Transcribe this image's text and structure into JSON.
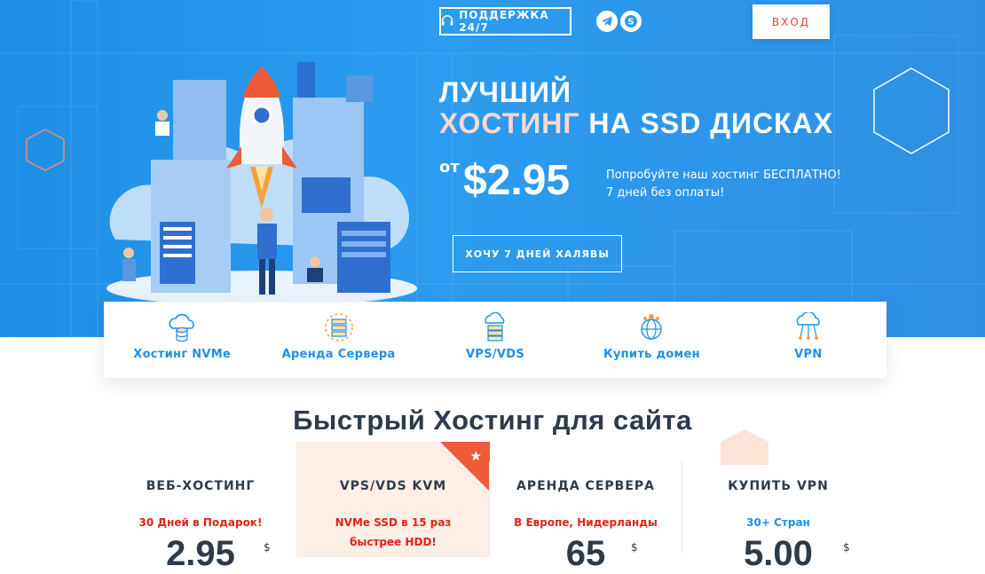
{
  "header": {
    "support_label": "ПОДДЕРЖКА 24/7",
    "support_icon": "headset-icon",
    "social": [
      {
        "icon": "telegram-icon"
      },
      {
        "icon": "skype-icon"
      }
    ],
    "login_label": "ВХОД"
  },
  "hero": {
    "title_line1": "ЛУЧШИЙ",
    "title_line2_accent": "ХОСТИНГ",
    "title_line2_rest": " НА SSD ДИСКАХ",
    "price_prefix": "от",
    "price": "$2.95",
    "promo_line1": "Попробуйте наш хостинг БЕСПЛАТНО!",
    "promo_line2": "7 дней без оплаты!",
    "cta_label": "ХОЧУ 7 ДНЕЙ ХАЛЯВЫ",
    "illustration": "rocket-datacenter-illustration"
  },
  "services": [
    {
      "label": "Хостинг NVMe",
      "icon": "cloud-database-icon"
    },
    {
      "label": "Аренда Сервера",
      "icon": "server-rack-icon"
    },
    {
      "label": "VPS/VDS",
      "icon": "cloud-server-icon"
    },
    {
      "label": "Купить домен",
      "icon": "globe-icon"
    },
    {
      "label": "VPN",
      "icon": "cloud-network-icon"
    }
  ],
  "section_title": "Быстрый Хостинг для сайта",
  "plans": [
    {
      "name": "ВЕБ-ХОСТИНГ",
      "subtitle": "30 Дней в Подарок!",
      "subtitle_color": "#e0241b",
      "price": "2.95",
      "currency": "$",
      "featured": false
    },
    {
      "name": "VPS/VDS KVM",
      "subtitle": "NVMe SSD в 15 раз быстрее HDD!",
      "subtitle_color": "#e0241b",
      "price": "",
      "currency": "",
      "featured": true,
      "badge_icon": "star-icon"
    },
    {
      "name": "АРЕНДА СЕРВЕРА",
      "subtitle": "В Европе, Нидерланды",
      "subtitle_color": "#e0241b",
      "price": "65",
      "currency": "$",
      "featured": false
    },
    {
      "name": "КУПИТЬ VPN",
      "subtitle": "30+ Стран",
      "subtitle_color": "#1f8fe6",
      "price": "5.00",
      "currency": "$",
      "featured": false
    }
  ],
  "colors": {
    "hero_blue": "#2b9cef",
    "accent_orange": "#ee5b36",
    "brand_blue": "#1f8fe6",
    "dark_text": "#2d3a4a"
  }
}
